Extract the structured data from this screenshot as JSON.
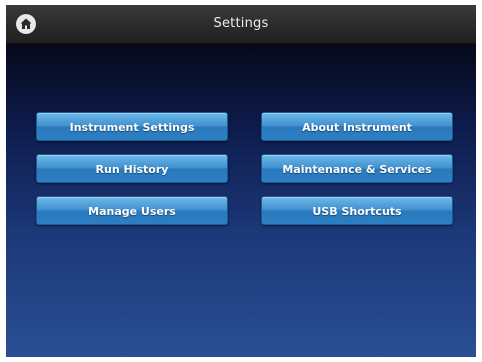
{
  "header": {
    "title": "Settings",
    "home_icon": "home-icon"
  },
  "menu": {
    "left": [
      {
        "label": "Instrument Settings"
      },
      {
        "label": "Run History"
      },
      {
        "label": "Manage Users"
      }
    ],
    "right": [
      {
        "label": "About Instrument"
      },
      {
        "label": "Maintenance & Services"
      },
      {
        "label": "USB Shortcuts"
      }
    ]
  },
  "colors": {
    "titlebar": "#2b2b2b",
    "button": "#3f90cf",
    "background_top": "#06091a",
    "background_bottom": "#2a4f94"
  }
}
